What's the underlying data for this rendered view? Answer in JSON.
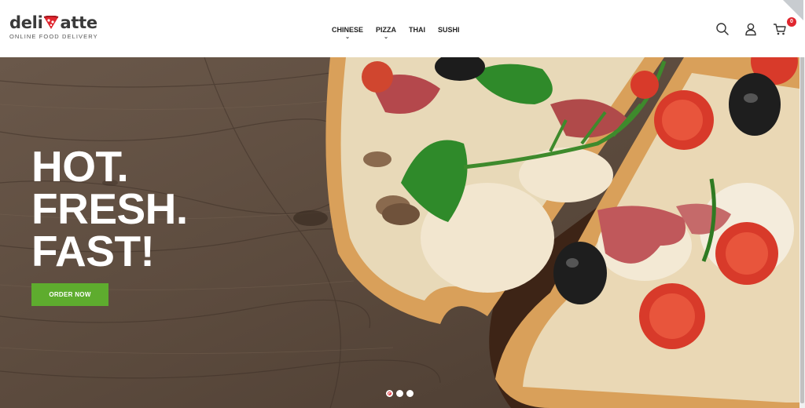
{
  "brand": {
    "name_left": "deli",
    "name_right": "atte",
    "tagline": "ONLINE FOOD DELIVERY",
    "accent": "#e0262f"
  },
  "nav": {
    "items": [
      {
        "label": "CHINESE",
        "has_dropdown": true
      },
      {
        "label": "PIZZA",
        "has_dropdown": true
      },
      {
        "label": "THAI",
        "has_dropdown": false
      },
      {
        "label": "SUSHI",
        "has_dropdown": false
      }
    ]
  },
  "header_icons": [
    "search-icon",
    "user-icon",
    "cart-icon"
  ],
  "cart": {
    "count": "0"
  },
  "hero": {
    "headline": [
      "HOT.",
      "FRESH.",
      "FAST!"
    ],
    "cta_label": "ORDER NOW",
    "cta_color": "#5eac2e",
    "slides": 3,
    "active_slide": 1
  }
}
